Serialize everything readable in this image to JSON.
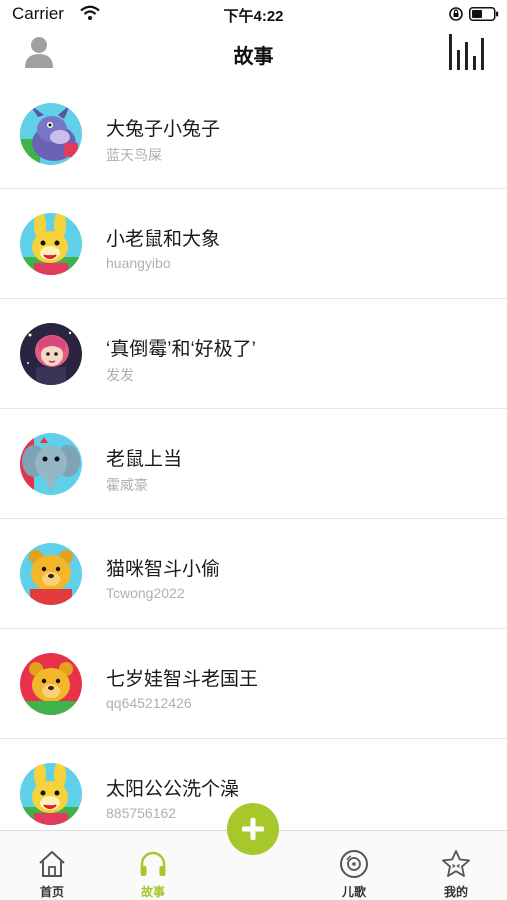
{
  "status_bar": {
    "carrier": "Carrier",
    "time": "下午4:22"
  },
  "nav": {
    "title": "故事",
    "left_icon": "user-avatar-icon",
    "right_icon": "now-playing-bars-icon"
  },
  "stories": [
    {
      "title": "大兔子小兔子",
      "author": "蓝天鸟屎",
      "thumb_icon": "eeyore-avatar-icon"
    },
    {
      "title": "小老鼠和大象",
      "author": "huangyibo",
      "thumb_icon": "rabbit-avatar-icon"
    },
    {
      "title": "‘真倒霉’和‘好极了’",
      "author": "发发",
      "thumb_icon": "girl-avatar-icon"
    },
    {
      "title": "老鼠上当",
      "author": "霍威豪",
      "thumb_icon": "elephant-avatar-icon"
    },
    {
      "title": "猫咪智斗小偷",
      "author": "Tcwong2022",
      "thumb_icon": "pooh-avatar-icon"
    },
    {
      "title": "七岁娃智斗老国王",
      "author": "qq645212426",
      "thumb_icon": "pooh-avatar-icon"
    },
    {
      "title": "太阳公公洗个澡",
      "author": "885756162",
      "thumb_icon": "rabbit-avatar-icon"
    }
  ],
  "tabs": [
    {
      "label": "首页",
      "icon": "home-icon",
      "active": false
    },
    {
      "label": "故事",
      "icon": "headphones-icon",
      "active": true
    },
    {
      "label": "儿歌",
      "icon": "disc-icon",
      "active": false
    },
    {
      "label": "我的",
      "icon": "star-face-icon",
      "active": false
    }
  ],
  "center_button_icon": "plus-icon",
  "colors": {
    "accent": "#a6c82b",
    "text": "#1a1a1a",
    "subtext": "#b0b0b0",
    "divider": "#e6e6e6"
  }
}
